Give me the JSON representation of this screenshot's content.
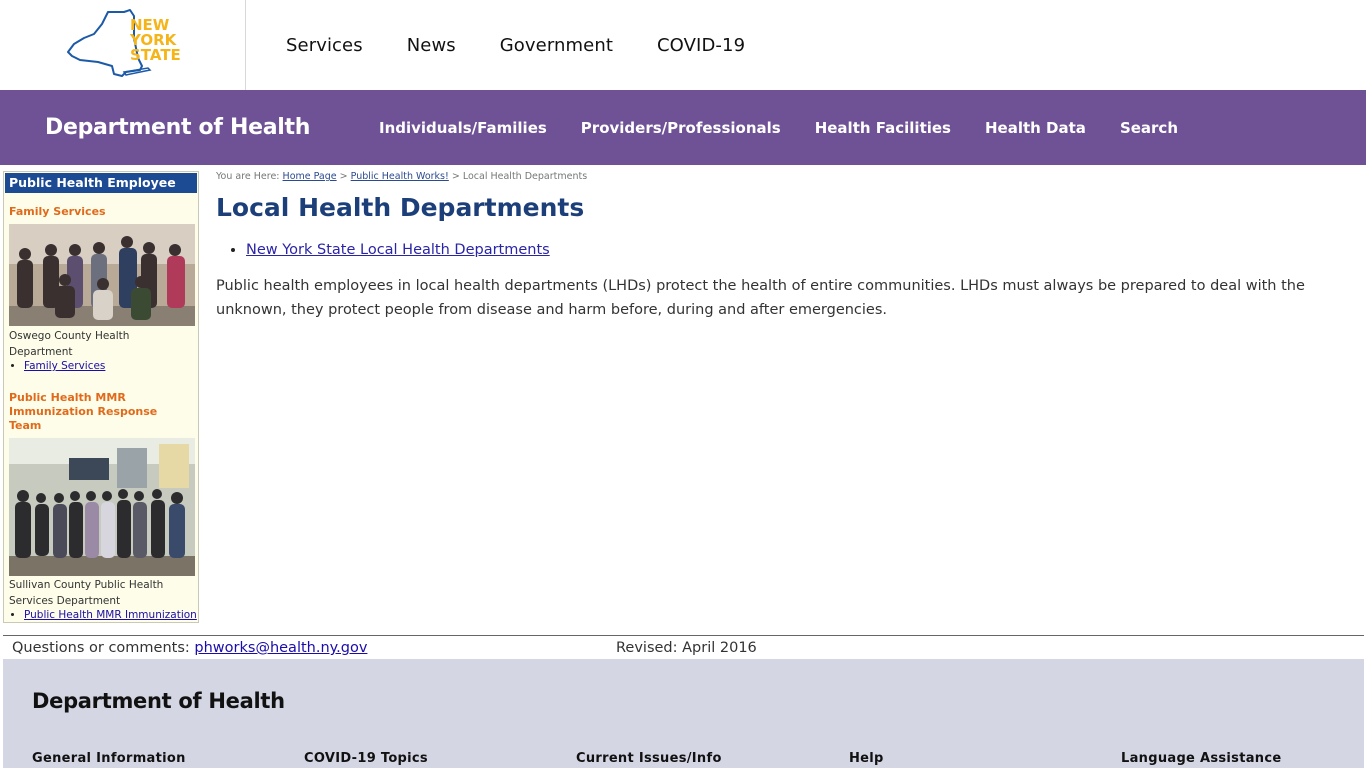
{
  "top": {
    "logo_text": [
      "NEW",
      "YORK",
      "STATE"
    ],
    "nav": [
      "Services",
      "News",
      "Government",
      "COVID-19"
    ]
  },
  "agency": {
    "title": "Department of Health",
    "nav": [
      "Individuals/Families",
      "Providers/Professionals",
      "Health Facilities",
      "Health Data",
      "Search"
    ]
  },
  "sidebar": {
    "heading": "Public Health Employee",
    "sections": [
      {
        "title": "Family Services",
        "caption": "Oswego County Health Department",
        "link": "Family Services"
      },
      {
        "title": "Public Health MMR Immunization Response Team",
        "caption": "Sullivan County Public Health Services Department",
        "link": "Public Health MMR Immunization Response Team"
      }
    ]
  },
  "breadcrumb": {
    "prefix": "You are Here:",
    "links": [
      "Home Page",
      "Public Health Works!"
    ],
    "current": "Local Health Departments"
  },
  "main": {
    "title": "Local Health Departments",
    "links": [
      "New York State Local Health Departments"
    ],
    "paragraph": "Public health employees in local health departments (LHDs) protect the health of entire communities. LHDs must always be prepared to deal with the unknown, they protect people from disease and harm before, during and after emergencies."
  },
  "page_footer": {
    "questions_label": "Questions or comments:",
    "email": "phworks@health.ny.gov",
    "revised": "Revised: April 2016"
  },
  "site_footer": {
    "title": "Department of Health",
    "columns": [
      "General Information",
      "COVID-19 Topics",
      "Current Issues/Info",
      "Help",
      "Language Assistance"
    ]
  },
  "colors": {
    "agency_bar": "#6f5296",
    "sidebar_head": "#1c4a93",
    "sidebar_bg": "#fefde9",
    "section_title": "#e06a1b",
    "page_title": "#1c3f7a",
    "footer_bg": "#d4d6e4",
    "logo_yellow": "#f4b41a",
    "logo_blue": "#1c5aa8"
  }
}
